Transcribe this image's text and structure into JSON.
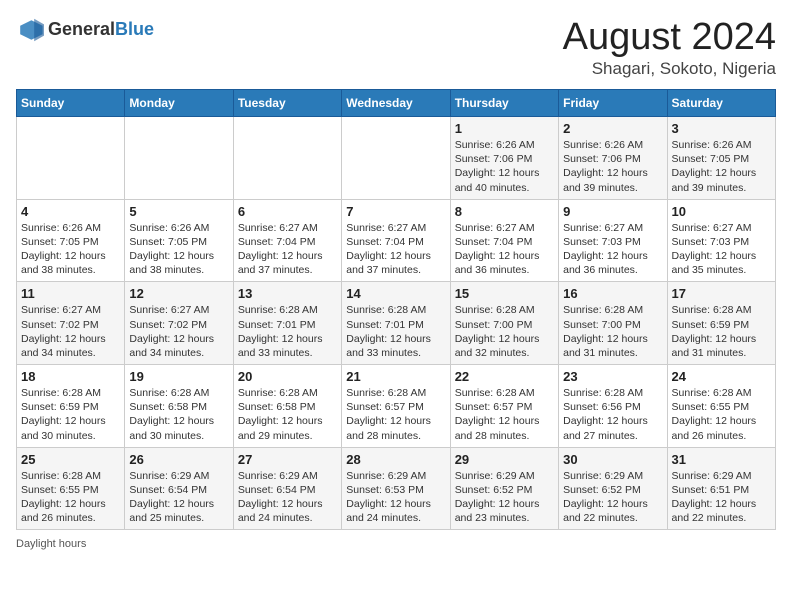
{
  "header": {
    "logo_general": "General",
    "logo_blue": "Blue",
    "title": "August 2024",
    "subtitle": "Shagari, Sokoto, Nigeria"
  },
  "calendar": {
    "weekdays": [
      "Sunday",
      "Monday",
      "Tuesday",
      "Wednesday",
      "Thursday",
      "Friday",
      "Saturday"
    ],
    "weeks": [
      [
        {
          "day": "",
          "info": ""
        },
        {
          "day": "",
          "info": ""
        },
        {
          "day": "",
          "info": ""
        },
        {
          "day": "",
          "info": ""
        },
        {
          "day": "1",
          "info": "Sunrise: 6:26 AM\nSunset: 7:06 PM\nDaylight: 12 hours and 40 minutes."
        },
        {
          "day": "2",
          "info": "Sunrise: 6:26 AM\nSunset: 7:06 PM\nDaylight: 12 hours and 39 minutes."
        },
        {
          "day": "3",
          "info": "Sunrise: 6:26 AM\nSunset: 7:05 PM\nDaylight: 12 hours and 39 minutes."
        }
      ],
      [
        {
          "day": "4",
          "info": "Sunrise: 6:26 AM\nSunset: 7:05 PM\nDaylight: 12 hours and 38 minutes."
        },
        {
          "day": "5",
          "info": "Sunrise: 6:26 AM\nSunset: 7:05 PM\nDaylight: 12 hours and 38 minutes."
        },
        {
          "day": "6",
          "info": "Sunrise: 6:27 AM\nSunset: 7:04 PM\nDaylight: 12 hours and 37 minutes."
        },
        {
          "day": "7",
          "info": "Sunrise: 6:27 AM\nSunset: 7:04 PM\nDaylight: 12 hours and 37 minutes."
        },
        {
          "day": "8",
          "info": "Sunrise: 6:27 AM\nSunset: 7:04 PM\nDaylight: 12 hours and 36 minutes."
        },
        {
          "day": "9",
          "info": "Sunrise: 6:27 AM\nSunset: 7:03 PM\nDaylight: 12 hours and 36 minutes."
        },
        {
          "day": "10",
          "info": "Sunrise: 6:27 AM\nSunset: 7:03 PM\nDaylight: 12 hours and 35 minutes."
        }
      ],
      [
        {
          "day": "11",
          "info": "Sunrise: 6:27 AM\nSunset: 7:02 PM\nDaylight: 12 hours and 34 minutes."
        },
        {
          "day": "12",
          "info": "Sunrise: 6:27 AM\nSunset: 7:02 PM\nDaylight: 12 hours and 34 minutes."
        },
        {
          "day": "13",
          "info": "Sunrise: 6:28 AM\nSunset: 7:01 PM\nDaylight: 12 hours and 33 minutes."
        },
        {
          "day": "14",
          "info": "Sunrise: 6:28 AM\nSunset: 7:01 PM\nDaylight: 12 hours and 33 minutes."
        },
        {
          "day": "15",
          "info": "Sunrise: 6:28 AM\nSunset: 7:00 PM\nDaylight: 12 hours and 32 minutes."
        },
        {
          "day": "16",
          "info": "Sunrise: 6:28 AM\nSunset: 7:00 PM\nDaylight: 12 hours and 31 minutes."
        },
        {
          "day": "17",
          "info": "Sunrise: 6:28 AM\nSunset: 6:59 PM\nDaylight: 12 hours and 31 minutes."
        }
      ],
      [
        {
          "day": "18",
          "info": "Sunrise: 6:28 AM\nSunset: 6:59 PM\nDaylight: 12 hours and 30 minutes."
        },
        {
          "day": "19",
          "info": "Sunrise: 6:28 AM\nSunset: 6:58 PM\nDaylight: 12 hours and 30 minutes."
        },
        {
          "day": "20",
          "info": "Sunrise: 6:28 AM\nSunset: 6:58 PM\nDaylight: 12 hours and 29 minutes."
        },
        {
          "day": "21",
          "info": "Sunrise: 6:28 AM\nSunset: 6:57 PM\nDaylight: 12 hours and 28 minutes."
        },
        {
          "day": "22",
          "info": "Sunrise: 6:28 AM\nSunset: 6:57 PM\nDaylight: 12 hours and 28 minutes."
        },
        {
          "day": "23",
          "info": "Sunrise: 6:28 AM\nSunset: 6:56 PM\nDaylight: 12 hours and 27 minutes."
        },
        {
          "day": "24",
          "info": "Sunrise: 6:28 AM\nSunset: 6:55 PM\nDaylight: 12 hours and 26 minutes."
        }
      ],
      [
        {
          "day": "25",
          "info": "Sunrise: 6:28 AM\nSunset: 6:55 PM\nDaylight: 12 hours and 26 minutes."
        },
        {
          "day": "26",
          "info": "Sunrise: 6:29 AM\nSunset: 6:54 PM\nDaylight: 12 hours and 25 minutes."
        },
        {
          "day": "27",
          "info": "Sunrise: 6:29 AM\nSunset: 6:54 PM\nDaylight: 12 hours and 24 minutes."
        },
        {
          "day": "28",
          "info": "Sunrise: 6:29 AM\nSunset: 6:53 PM\nDaylight: 12 hours and 24 minutes."
        },
        {
          "day": "29",
          "info": "Sunrise: 6:29 AM\nSunset: 6:52 PM\nDaylight: 12 hours and 23 minutes."
        },
        {
          "day": "30",
          "info": "Sunrise: 6:29 AM\nSunset: 6:52 PM\nDaylight: 12 hours and 22 minutes."
        },
        {
          "day": "31",
          "info": "Sunrise: 6:29 AM\nSunset: 6:51 PM\nDaylight: 12 hours and 22 minutes."
        }
      ]
    ]
  },
  "footer": {
    "note": "Daylight hours"
  }
}
